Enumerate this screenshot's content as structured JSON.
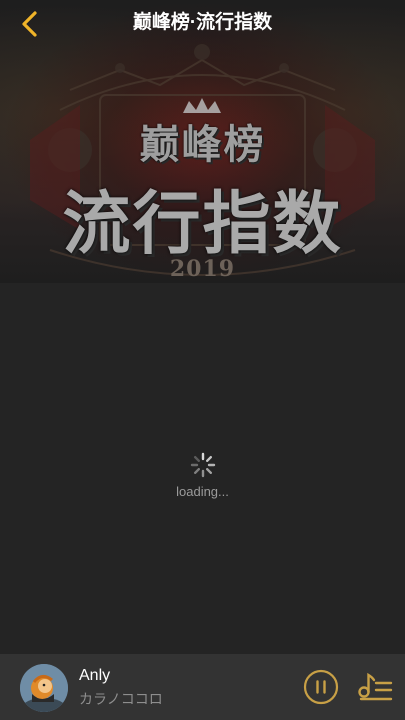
{
  "header": {
    "title": "巅峰榜·流行指数",
    "back_icon": "chevron-left-icon",
    "accent_color": "#f0b429"
  },
  "banner": {
    "subtitle": "巅峰榜",
    "title": "流行指数",
    "year": "2019"
  },
  "loading": {
    "text": "loading..."
  },
  "player": {
    "song_title": "Anly",
    "artist": "カラノココロ",
    "pause_icon": "pause-icon",
    "playlist_icon": "playlist-icon",
    "accent_color": "#c8a046"
  }
}
